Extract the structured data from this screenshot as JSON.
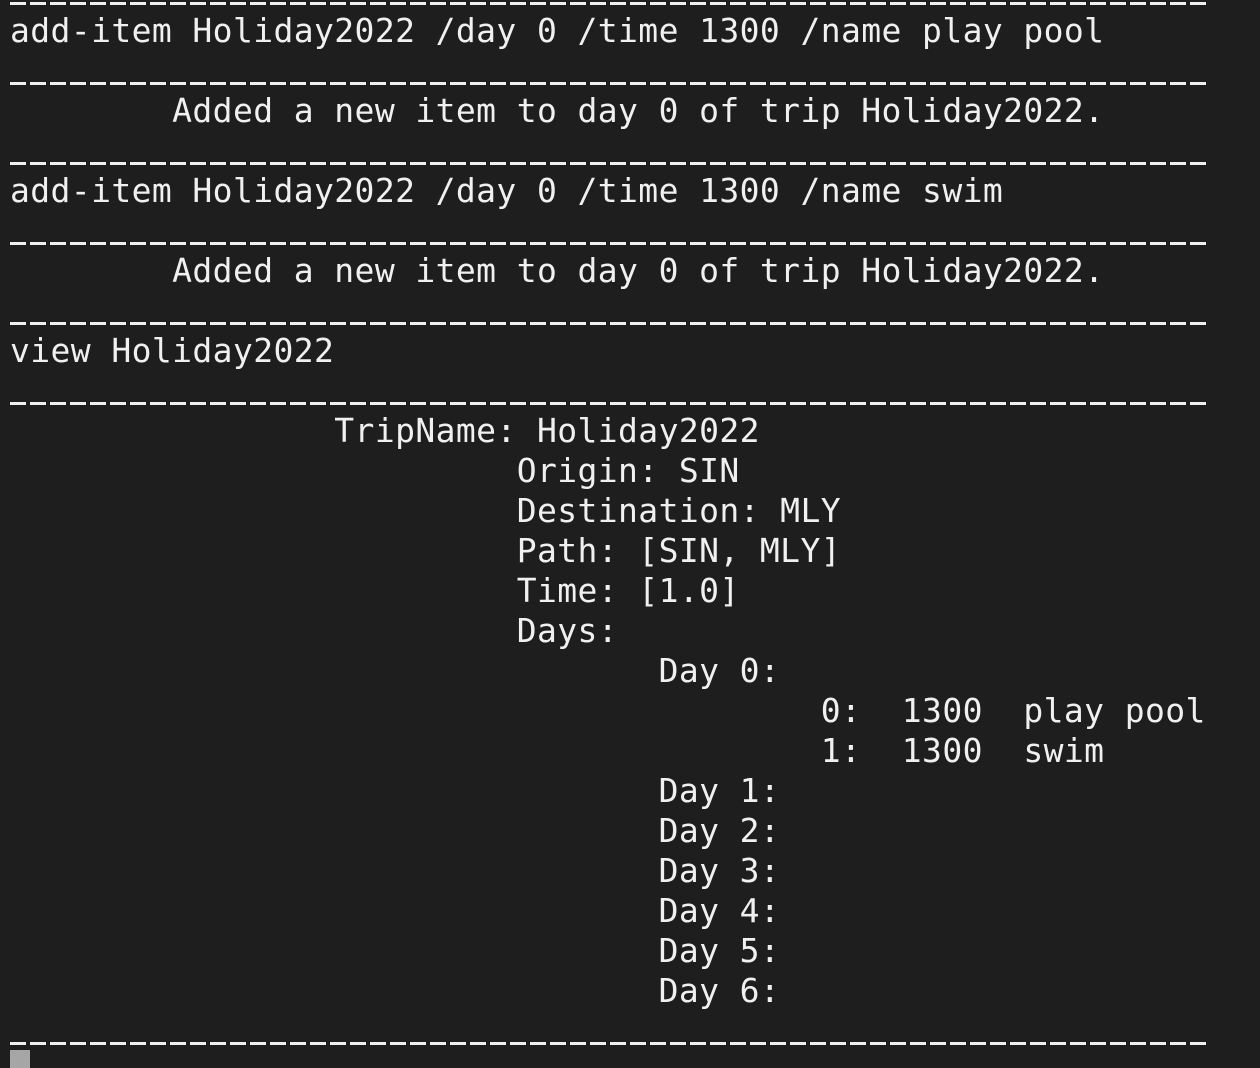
{
  "terminal": {
    "lines": [
      "add-item Holiday2022 /day 0 /time 1300 /name play pool",
      "        Added a new item to day 0 of trip Holiday2022.",
      "add-item Holiday2022 /day 0 /time 1300 /name swim",
      "        Added a new item to day 0 of trip Holiday2022.",
      "view Holiday2022",
      "                TripName: Holiday2022",
      "                         Origin: SIN",
      "                         Destination: MLY",
      "                         Path: [SIN, MLY]",
      "                         Time: [1.0]",
      "                         Days:",
      "                                Day 0:",
      "                                        0:  1300  play pool",
      "                                        1:  1300  swim",
      "                                Day 1:",
      "                                Day 2:",
      "                                Day 3:",
      "                                Day 4:",
      "                                Day 5:",
      "                                Day 6:"
    ]
  },
  "colors": {
    "background": "#1e1e1e",
    "text": "#f0f0f0",
    "cursor": "#a6a6a6"
  }
}
